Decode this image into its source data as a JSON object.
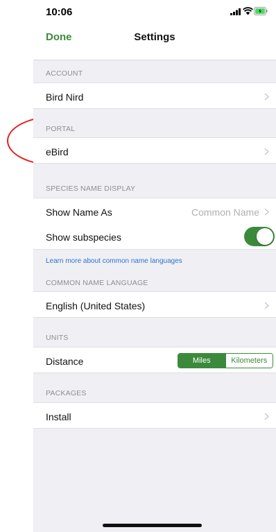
{
  "status": {
    "time": "10:06"
  },
  "nav": {
    "done_label": "Done",
    "title": "Settings"
  },
  "sections": {
    "account": {
      "header": "ACCOUNT",
      "row_label": "Bird Nird"
    },
    "portal": {
      "header": "PORTAL",
      "row_label": "eBird"
    },
    "species": {
      "header": "SPECIES NAME DISPLAY",
      "show_name_label": "Show Name As",
      "show_name_value": "Common Name",
      "subspecies_label": "Show subspecies",
      "subspecies_on": true,
      "learn_more": "Learn more about common name languages"
    },
    "language": {
      "header": "COMMON NAME LANGUAGE",
      "row_label": "English (United States)"
    },
    "units": {
      "header": "UNITS",
      "distance_label": "Distance",
      "options": [
        "Miles",
        "Kilometers"
      ],
      "selected": "Miles"
    },
    "packages": {
      "header": "PACKAGES",
      "row_label": "Install"
    }
  },
  "colors": {
    "accent": "#3b8a3b",
    "link": "#2e74c9",
    "annotation": "#e61e1e"
  },
  "icons": [
    "signal-icon",
    "wifi-icon",
    "battery-icon",
    "chevron-right-icon"
  ]
}
